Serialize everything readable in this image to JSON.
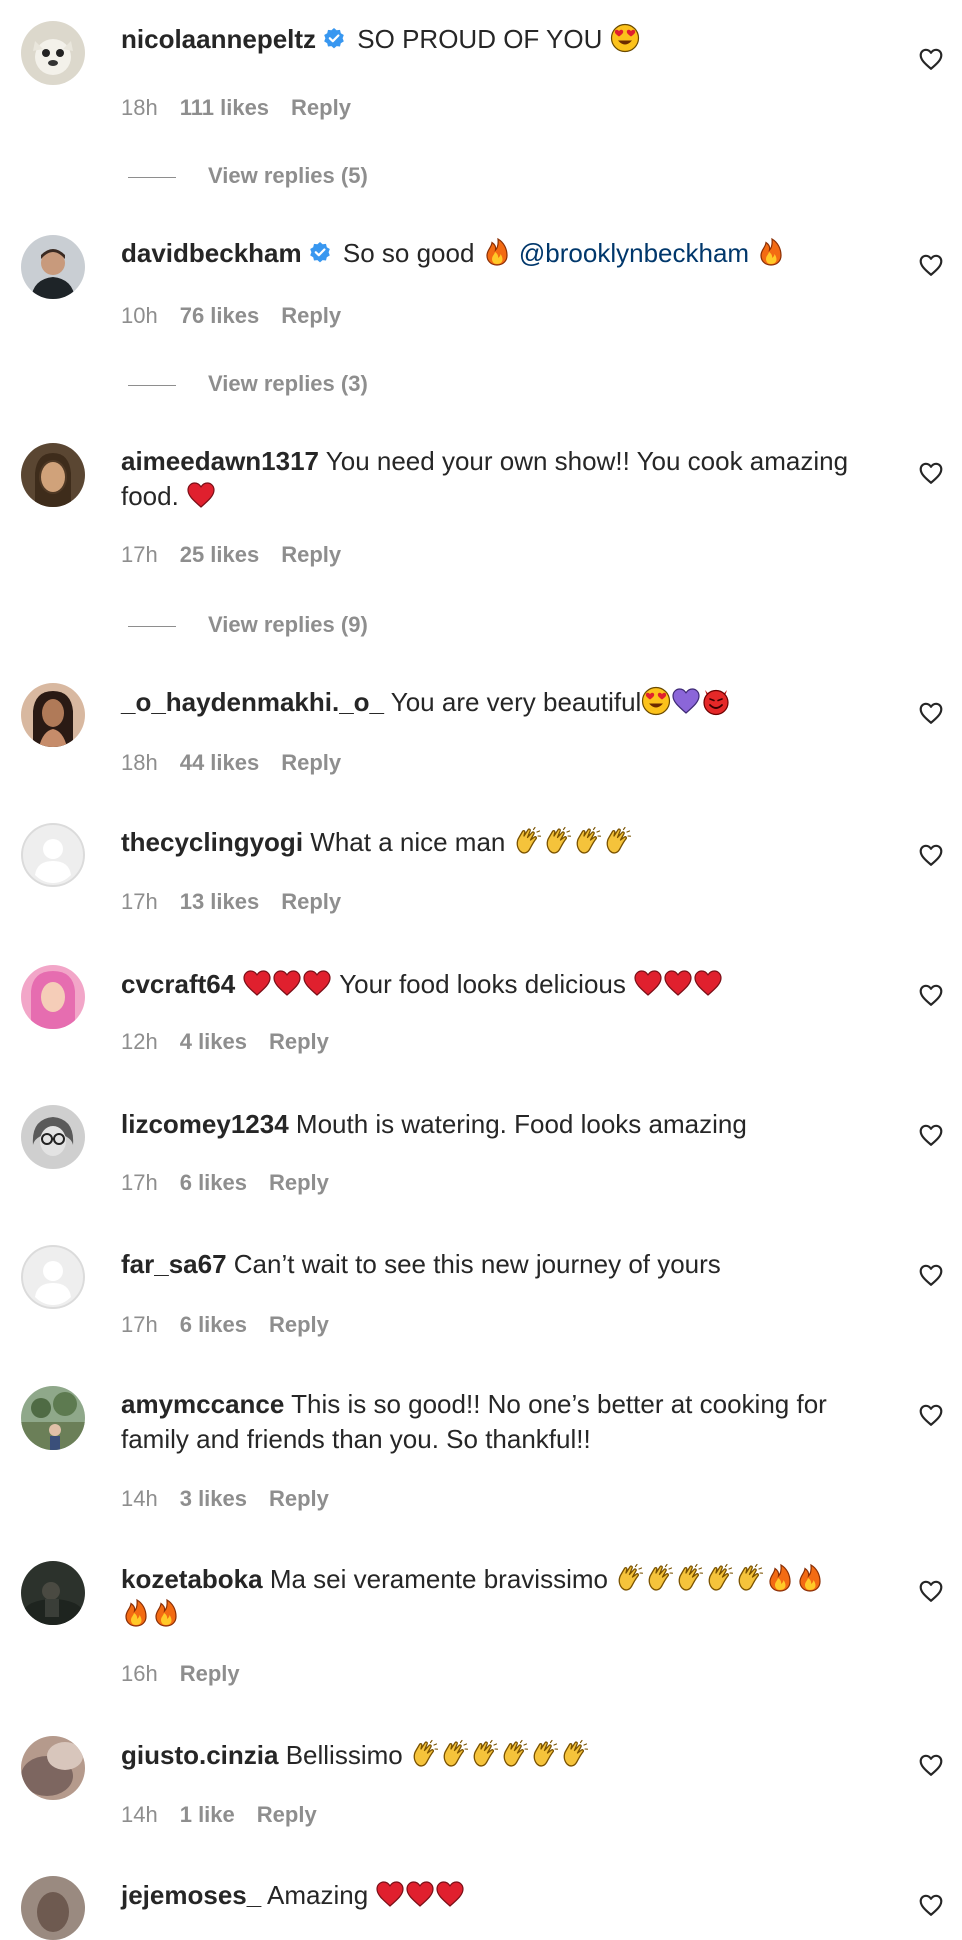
{
  "verified_color": "#3897f0",
  "heart_icon": "heart-outline-icon",
  "comments": [
    {
      "username": "nicolaannepeltz",
      "verified": true,
      "text": "SO PROUD OF YOU",
      "emoji_after": [
        "heart-eyes"
      ],
      "time": "18h",
      "likes": "111 likes",
      "reply": "Reply",
      "view_replies": "View replies (5)"
    },
    {
      "username": "davidbeckham",
      "verified": true,
      "text": "So so good",
      "mention": "@brooklynbeckham",
      "time": "10h",
      "likes": "76 likes",
      "reply": "Reply",
      "view_replies": "View replies (3)"
    },
    {
      "username": "aimeedawn1317",
      "text_line1": "You need your own show!! You cook amazing",
      "text_line2": "food.",
      "time": "17h",
      "likes": "25 likes",
      "reply": "Reply",
      "view_replies": "View replies (9)"
    },
    {
      "username": "_o_haydenmakhi._o_",
      "text": "You are very beautiful",
      "emoji_after": [
        "heart-eyes",
        "purple-heart",
        "smiling-devil"
      ],
      "time": "18h",
      "likes": "44 likes",
      "reply": "Reply"
    },
    {
      "username": "thecyclingyogi",
      "text": "What a nice man",
      "emoji_after": [
        "clap",
        "clap",
        "clap",
        "clap"
      ],
      "time": "17h",
      "likes": "13 likes",
      "reply": "Reply"
    },
    {
      "username": "cvcraft64",
      "text": "Your food looks delicious",
      "time": "12h",
      "likes": "4 likes",
      "reply": "Reply"
    },
    {
      "username": "lizcomey1234",
      "text": "Mouth is watering. Food looks amazing",
      "time": "17h",
      "likes": "6 likes",
      "reply": "Reply"
    },
    {
      "username": "far_sa67",
      "text": "Can’t wait to see this new journey of yours",
      "time": "17h",
      "likes": "6 likes",
      "reply": "Reply"
    },
    {
      "username": "amymccance",
      "text_line1": "This is so good!! No one’s better at cooking for",
      "text_line2": "family and friends than you. So thankful!!",
      "time": "14h",
      "likes": "3 likes",
      "reply": "Reply"
    },
    {
      "username": "kozetaboka",
      "text": "Ma sei veramente bravissimo",
      "time": "16h",
      "reply": "Reply"
    },
    {
      "username": "giusto.cinzia",
      "text": "Bellissimo",
      "time": "14h",
      "likes": "1 like",
      "reply": "Reply"
    },
    {
      "username": "jejemoses_",
      "text": "Amazing"
    }
  ]
}
